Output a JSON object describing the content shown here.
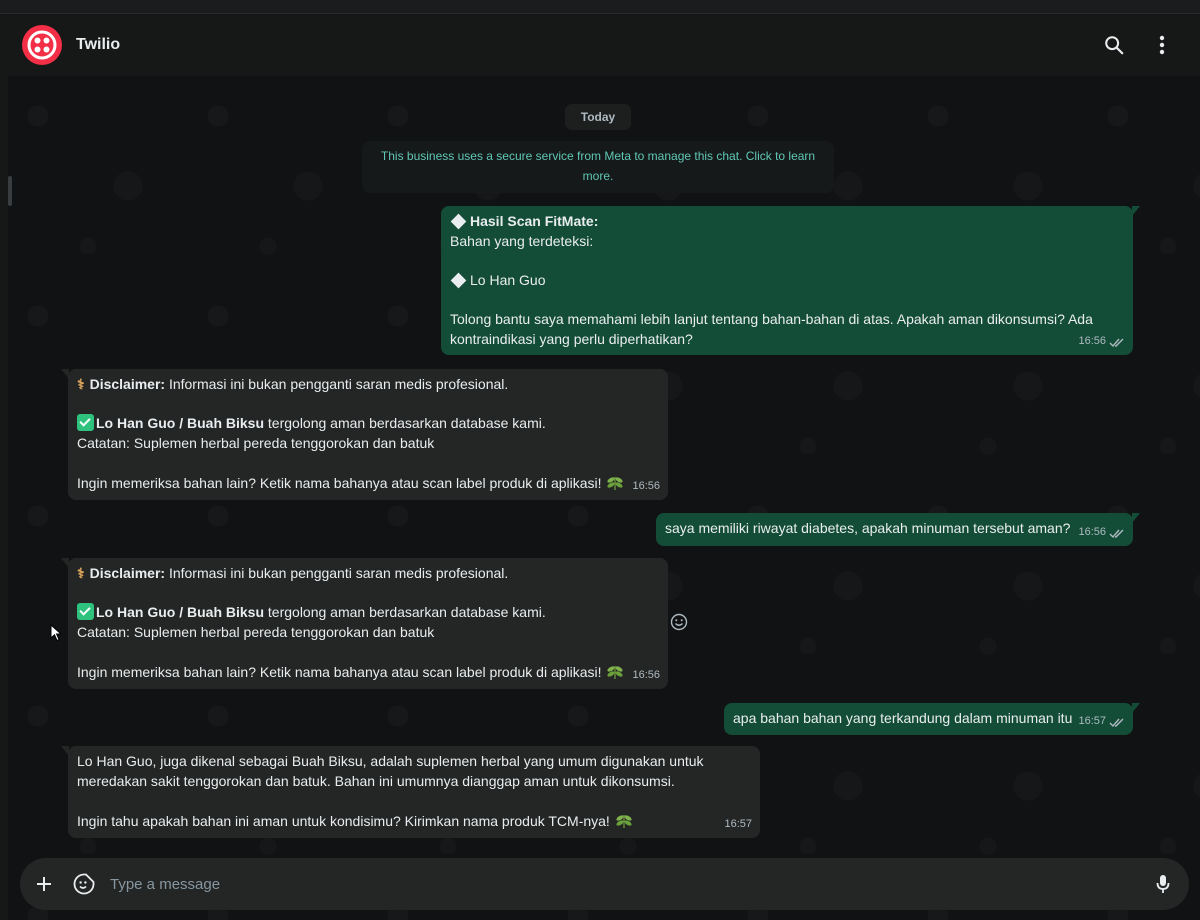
{
  "header": {
    "title": "Twilio",
    "icons": [
      "twilio-logo",
      "search-icon",
      "more-vertical-icon"
    ]
  },
  "chat": {
    "date": "Today",
    "system_note": "This business uses a secure service from Meta to manage this chat. Click to learn more.",
    "messages": {
      "m1": {
        "title": "Hasil Scan FitMate:",
        "line1": "Bahan yang terdeteksi:",
        "item": "Lo Han Guo",
        "body": "Tolong bantu saya memahami lebih lanjut tentang bahan-bahan di atas. Apakah aman dikonsumsi? Ada kontraindikasi yang perlu diperhatikan?",
        "time": "16:56"
      },
      "m2": {
        "disclaimer_label": "Disclaimer:",
        "disclaimer_text": " Informasi ini bukan pengganti saran medis profesional.",
        "product": "Lo Han Guo / Buah Biksu",
        "product_status": " tergolong aman berdasarkan database kami.",
        "note": "Catatan: Suplemen herbal pereda tenggorokan dan batuk",
        "prompt": "Ingin memeriksa bahan lain? Ketik nama bahanya atau scan label produk di aplikasi!",
        "time": "16:56"
      },
      "m3": {
        "text": "saya memiliki riwayat diabetes, apakah minuman tersebut aman?",
        "time": "16:56"
      },
      "m4": {
        "disclaimer_label": "Disclaimer:",
        "disclaimer_text": " Informasi ini bukan pengganti saran medis profesional.",
        "product": "Lo Han Guo / Buah Biksu",
        "product_status": " tergolong aman berdasarkan database kami.",
        "note": "Catatan: Suplemen herbal pereda tenggorokan dan batuk",
        "prompt": "Ingin memeriksa bahan lain? Ketik nama bahanya atau scan label produk di aplikasi!",
        "time": "16:56"
      },
      "m5": {
        "text": "apa bahan bahan yang terkandung dalam minuman itu",
        "time": "16:57"
      },
      "m6": {
        "p1": "Lo Han Guo, juga dikenal sebagai Buah Biksu, adalah suplemen herbal yang umum digunakan untuk meredakan sakit tenggorokan dan batuk. Bahan ini umumnya dianggap aman untuk dikonsumsi.",
        "p2": "Ingin tahu apakah bahan ini aman untuk kondisimu? Kirimkan nama produk TCM-nya!",
        "time": "16:57"
      }
    }
  },
  "composer": {
    "placeholder": "Type a message"
  },
  "colors": {
    "outgoing_bubble": "#144d37",
    "incoming_bubble": "#242626",
    "brand": "#f22f46",
    "system_text": "#5fc8b5"
  }
}
